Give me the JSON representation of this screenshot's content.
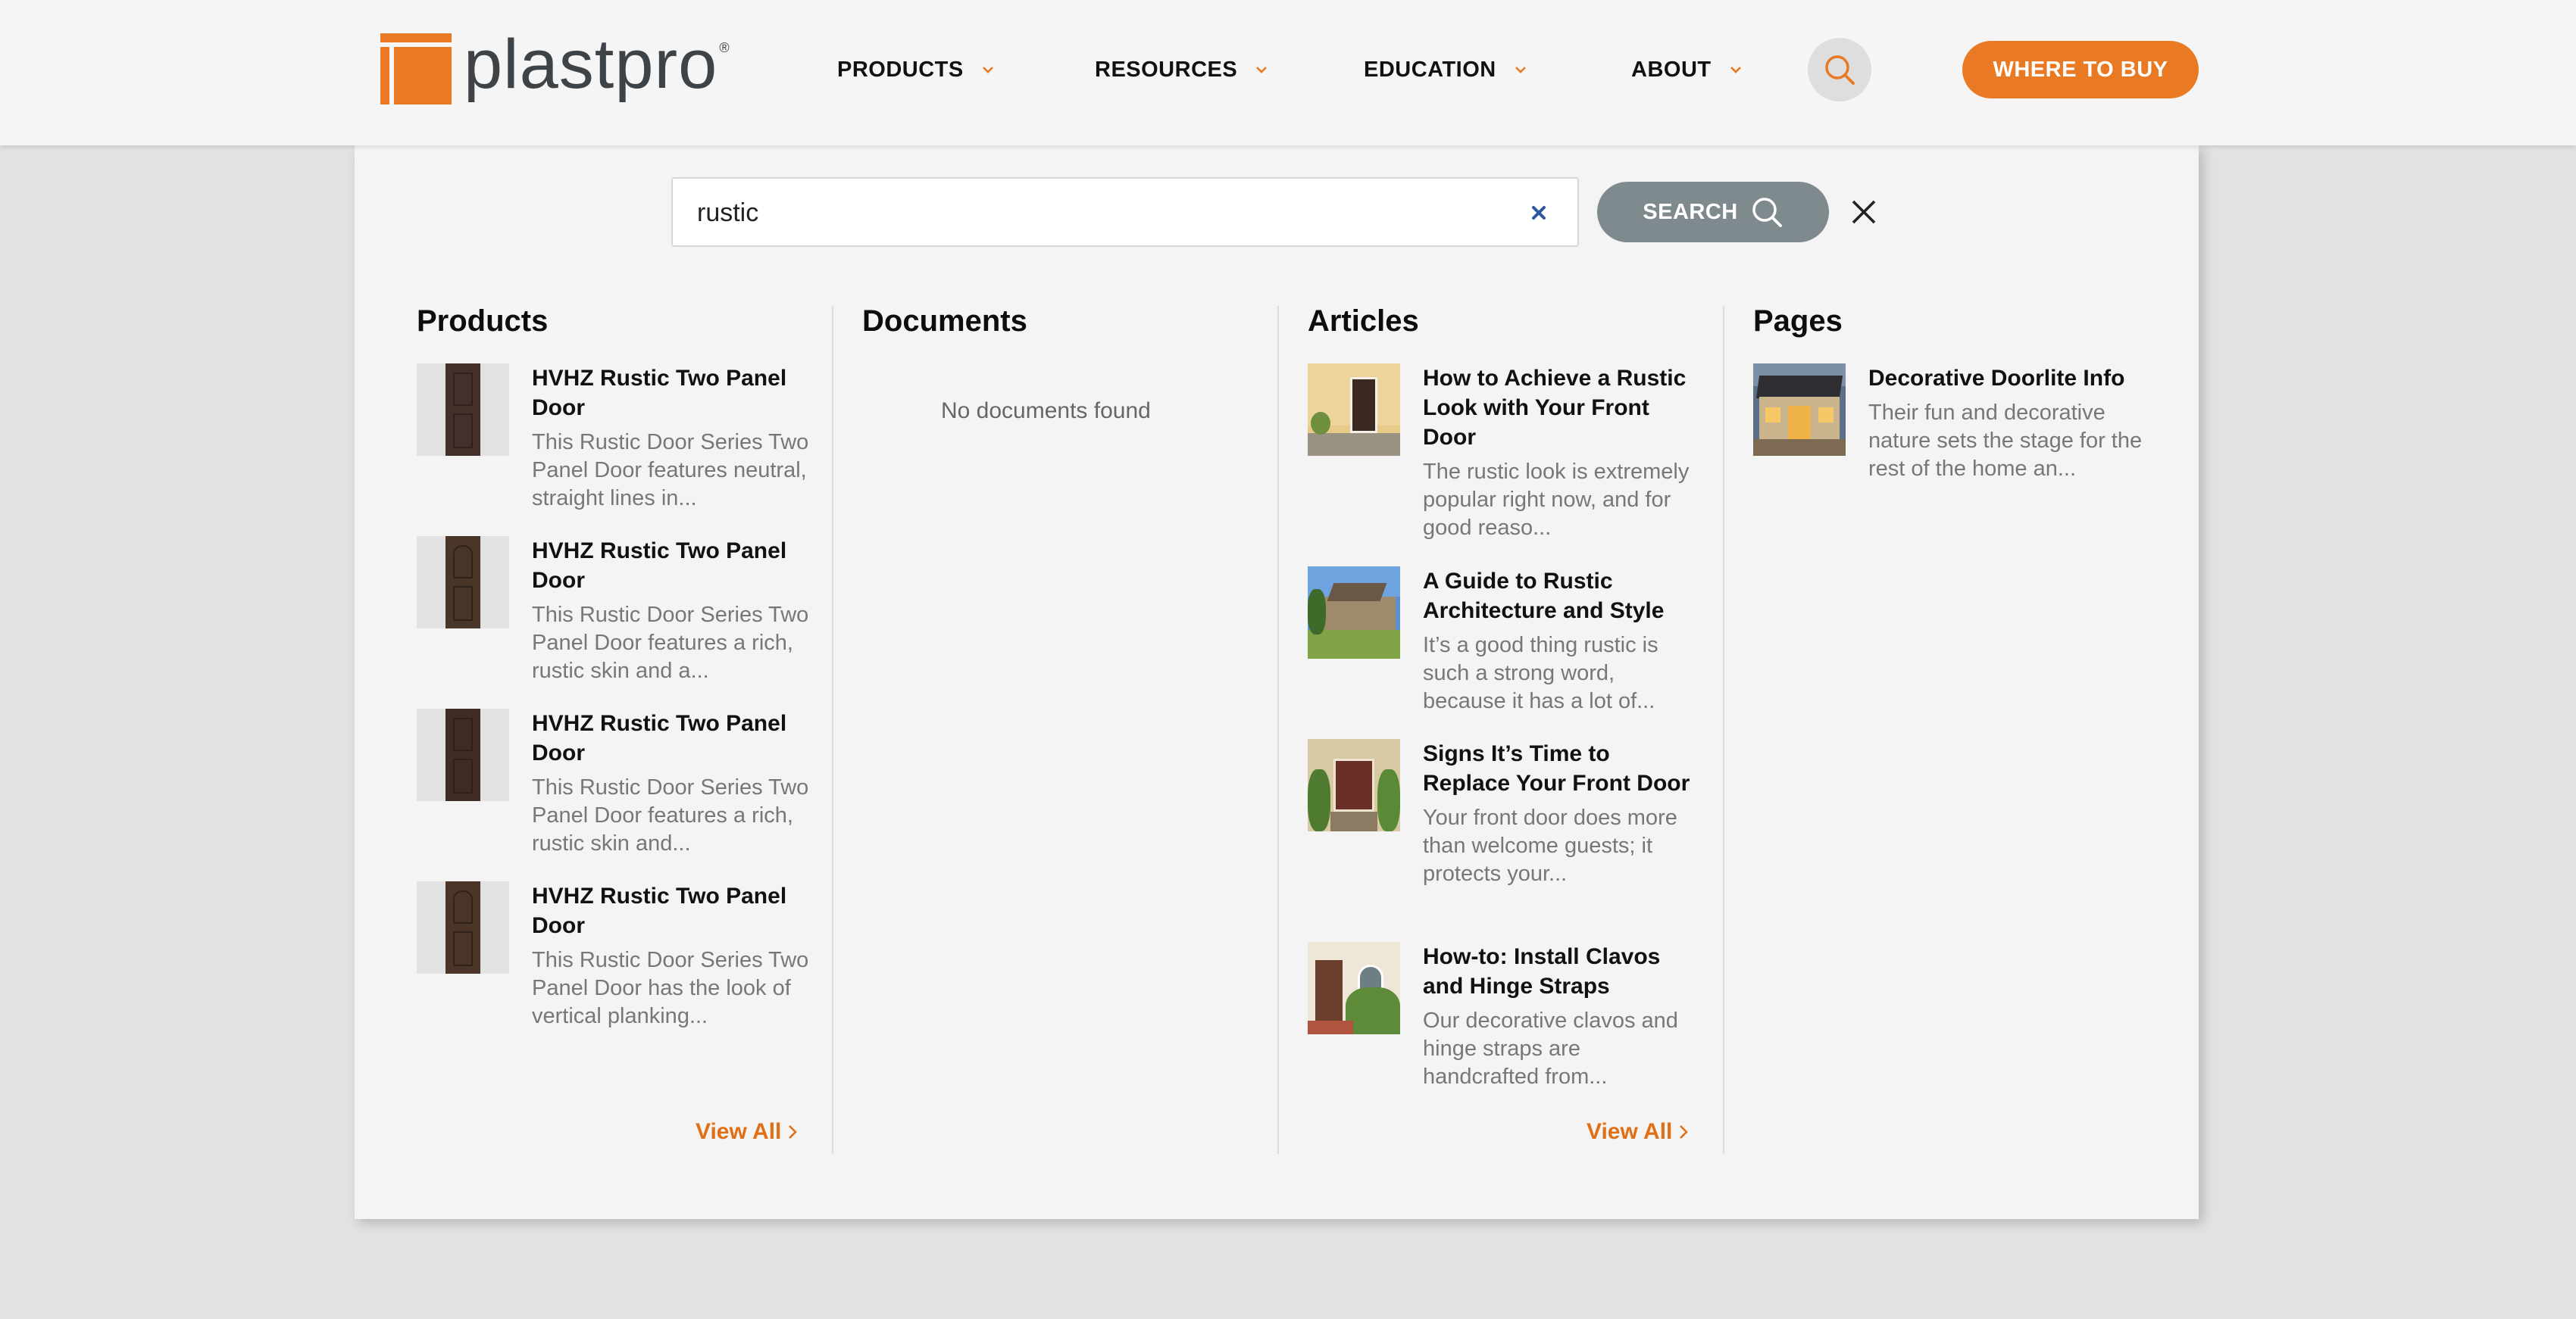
{
  "brand": {
    "name": "plastpro",
    "registered": "®",
    "accent": "#e97a23"
  },
  "nav": {
    "items": [
      {
        "label": "PRODUCTS"
      },
      {
        "label": "RESOURCES"
      },
      {
        "label": "EDUCATION"
      },
      {
        "label": "ABOUT"
      }
    ],
    "cta_label": "WHERE TO BUY"
  },
  "search": {
    "value": "rustic",
    "button_label": "SEARCH"
  },
  "results": {
    "products": {
      "title": "Products",
      "items": [
        {
          "title": "HVHZ Rustic Two Panel Door",
          "desc": "This Rustic Door Series Two Panel Door features neutral, straight lines in..."
        },
        {
          "title": "HVHZ Rustic Two Panel Door",
          "desc": "This Rustic Door Series Two Panel Door features a rich, rustic skin and a..."
        },
        {
          "title": "HVHZ Rustic Two Panel Door",
          "desc": "This Rustic Door Series Two Panel Door features a rich, rustic skin and..."
        },
        {
          "title": "HVHZ Rustic Two Panel Door",
          "desc": "This Rustic Door Series Two Panel Door has the look of vertical planking..."
        }
      ],
      "view_all": "View All"
    },
    "documents": {
      "title": "Documents",
      "empty": "No documents found"
    },
    "articles": {
      "title": "Articles",
      "items": [
        {
          "title": "How to Achieve a Rustic Look with Your Front Door",
          "desc": "The rustic look is extremely popular right now, and for good reaso..."
        },
        {
          "title": "A Guide to Rustic Architecture and Style",
          "desc": "It’s a good thing rustic is such a strong word, because it has a lot of..."
        },
        {
          "title": "Signs It’s Time to Replace Your Front Door",
          "desc": "Your front door does more than welcome guests; it protects your..."
        },
        {
          "title": "How-to: Install Clavos and Hinge Straps",
          "desc": "Our decorative clavos and hinge straps are handcrafted from..."
        }
      ],
      "view_all": "View All"
    },
    "pages": {
      "title": "Pages",
      "items": [
        {
          "title": "Decorative Doorlite Info",
          "desc": "Their fun and decorative nature sets the stage for the rest of the home an..."
        }
      ]
    }
  }
}
